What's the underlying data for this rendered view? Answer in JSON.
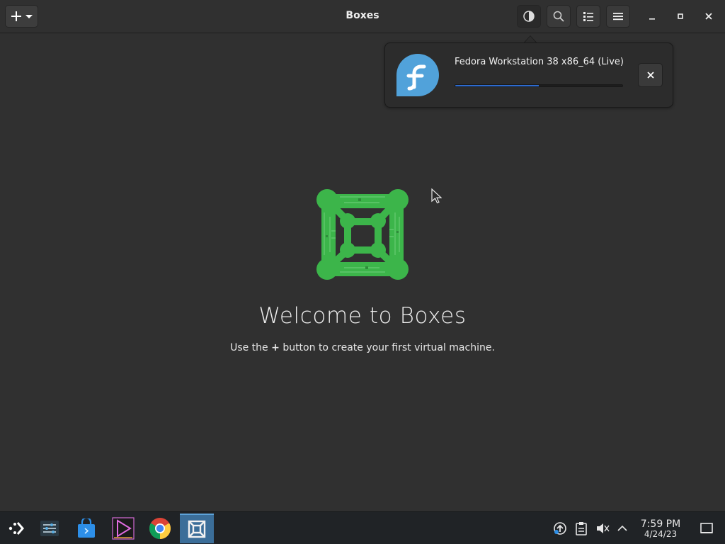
{
  "window": {
    "title": "Boxes"
  },
  "header": {
    "add_button_icon": "plus-icon",
    "dropdown_icon": "chevron-down-icon",
    "buttons": [
      "theme-toggle-icon",
      "search-icon",
      "list-view-icon",
      "main-menu-icon"
    ],
    "window_controls": [
      "minimize-icon",
      "maximize-icon",
      "close-icon"
    ]
  },
  "download": {
    "name": "Fedora Workstation 38 x86_64 (Live)",
    "progress": 0.5,
    "progress_color": "#2d6bd0",
    "logo_color": "#51a2da"
  },
  "empty_state": {
    "title": "Welcome to Boxes",
    "subtitle_before": "Use the",
    "subtitle_symbol": "+",
    "subtitle_after": "button to create your first virtual machine.",
    "logo_color": "#3cb54a"
  },
  "taskbar": {
    "apps": [
      "app-launcher-icon",
      "system-settings-icon",
      "discover-store-icon",
      "media-player-icon",
      "chrome-icon",
      "boxes-icon"
    ],
    "active_app": "boxes-icon",
    "tray": [
      "updates-icon",
      "clipboard-icon",
      "volume-muted-icon",
      "tray-expand-icon"
    ],
    "clock_time": "7:59 PM",
    "clock_date": "4/24/23",
    "show_desktop_icon": "show-desktop-icon"
  }
}
